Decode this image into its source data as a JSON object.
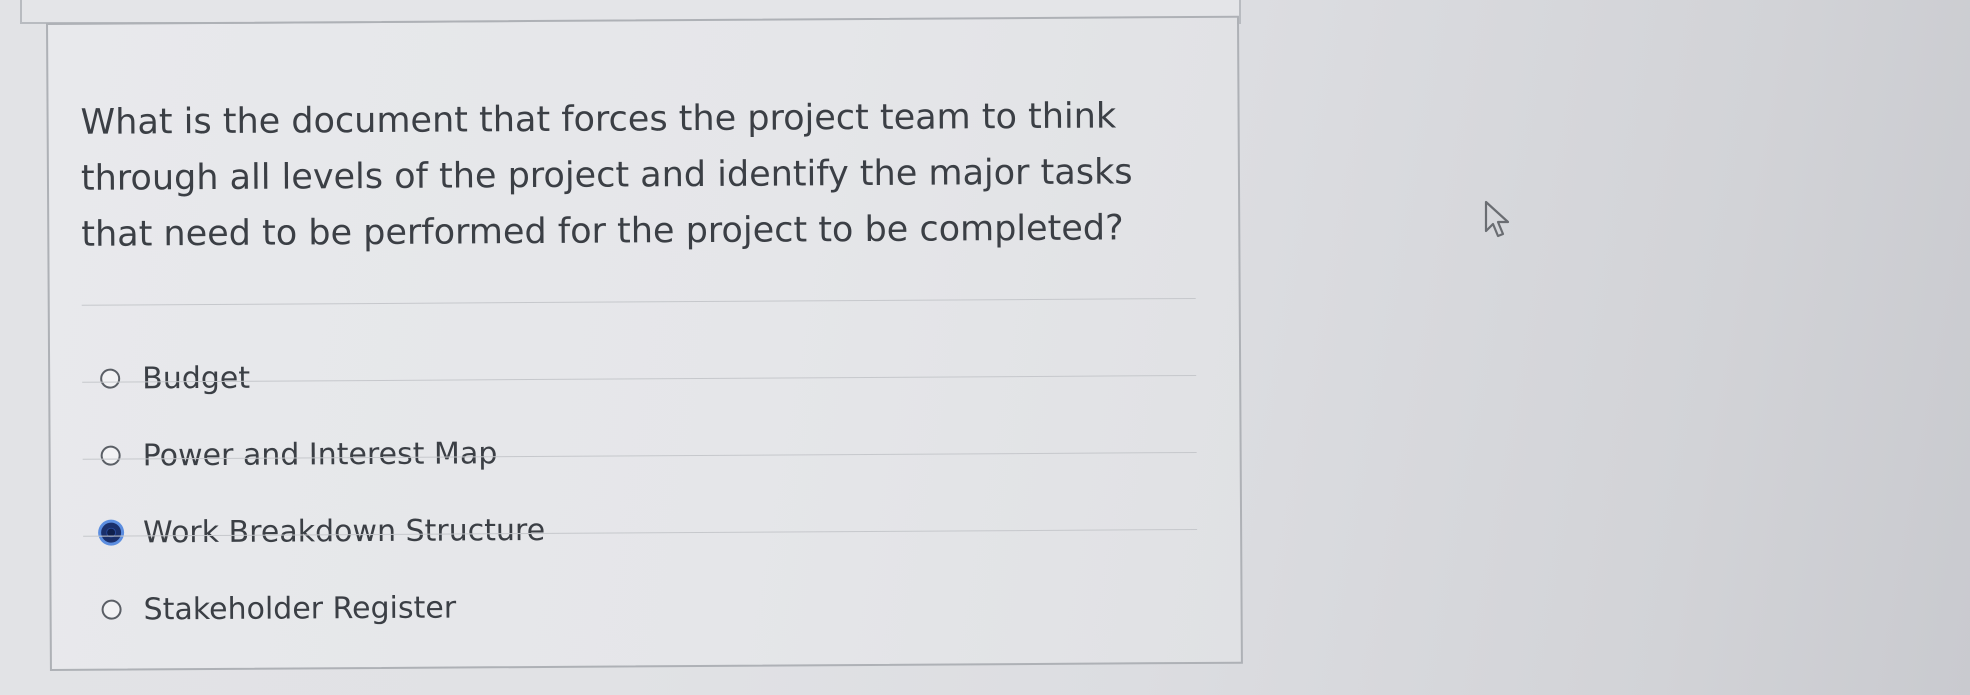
{
  "question": {
    "text": "What is the document that forces the project team to think through all levels of the project and identify the major tasks that need to be performed for the project to be completed?"
  },
  "options": [
    {
      "label": "Budget",
      "selected": false
    },
    {
      "label": "Power and Interest Map",
      "selected": false
    },
    {
      "label": "Work Breakdown Structure",
      "selected": true
    },
    {
      "label": "Stakeholder Register",
      "selected": false
    }
  ],
  "colors": {
    "selected_radio": "#1a2f6b",
    "focus_ring": "#5b8de0",
    "text": "#3b3f45",
    "background": "#e2e3e6"
  },
  "icons": {
    "cursor": "mouse-pointer-icon"
  }
}
